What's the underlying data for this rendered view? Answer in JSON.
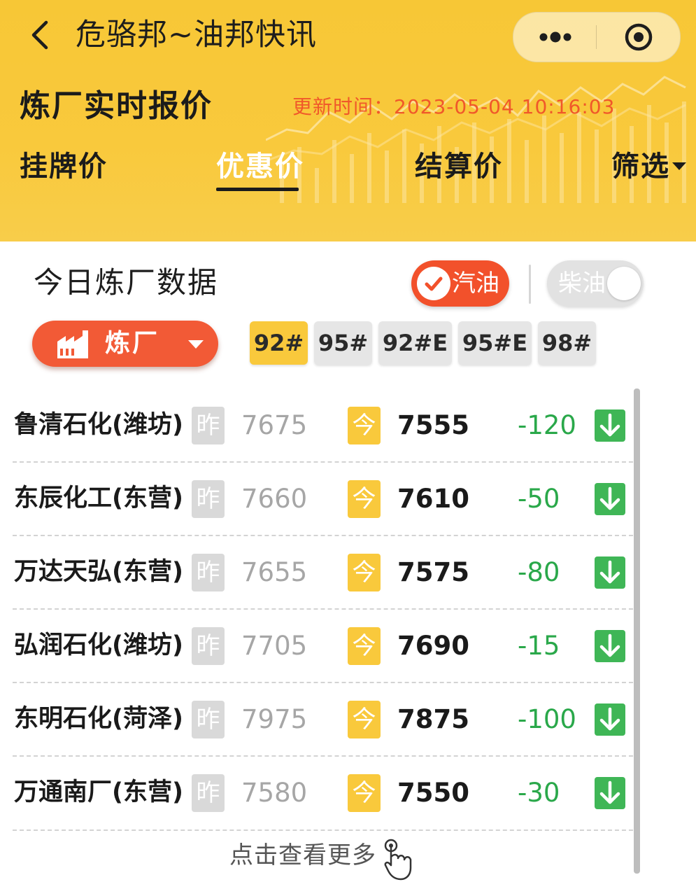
{
  "colors": {
    "header_bg": "#f9c93c",
    "accent_orange": "#f25a36",
    "price_down_green": "#2aa84a",
    "update_time_red": "#f0582a"
  },
  "nav": {
    "title": "危骆邦~油邦快讯",
    "back_icon": "chevron-left-icon",
    "more_icon": "more-dots-icon",
    "close_icon": "target-close-icon"
  },
  "header": {
    "page_title": "炼厂实时报价",
    "update_time": "更新时间：2023-05-04 10:16:03",
    "tabs": [
      {
        "label": "挂牌价",
        "active": false
      },
      {
        "label": "优惠价",
        "active": true
      },
      {
        "label": "结算价",
        "active": false
      }
    ],
    "filter_label": "筛选"
  },
  "section": {
    "title": "今日炼厂数据",
    "fuel_toggle": {
      "gasoline": {
        "label": "汽油",
        "selected": true
      },
      "diesel": {
        "label": "柴油",
        "selected": false
      }
    },
    "refinery_dropdown": {
      "label": "炼厂",
      "icon": "factory-icon"
    },
    "grades": [
      {
        "label": "92#",
        "active": true
      },
      {
        "label": "95#",
        "active": false
      },
      {
        "label": "92#E",
        "active": false
      },
      {
        "label": "95#E",
        "active": false
      },
      {
        "label": "98#",
        "active": false
      }
    ]
  },
  "labels": {
    "yesterday": "昨",
    "today": "今"
  },
  "rows": [
    {
      "name": "鲁清石化(潍坊)",
      "yesterday": "7675",
      "today": "7555",
      "change": "-120"
    },
    {
      "name": "东辰化工(东营)",
      "yesterday": "7660",
      "today": "7610",
      "change": "-50"
    },
    {
      "name": "万达天弘(东营)",
      "yesterday": "7655",
      "today": "7575",
      "change": "-80"
    },
    {
      "name": "弘润石化(潍坊)",
      "yesterday": "7705",
      "today": "7690",
      "change": "-15"
    },
    {
      "name": "东明石化(菏泽)",
      "yesterday": "7975",
      "today": "7875",
      "change": "-100"
    },
    {
      "name": "万通南厂(东营)",
      "yesterday": "7580",
      "today": "7550",
      "change": "-30"
    }
  ],
  "footer": {
    "more_label": "点击查看更多",
    "hand_icon": "hand-pointer-icon"
  }
}
